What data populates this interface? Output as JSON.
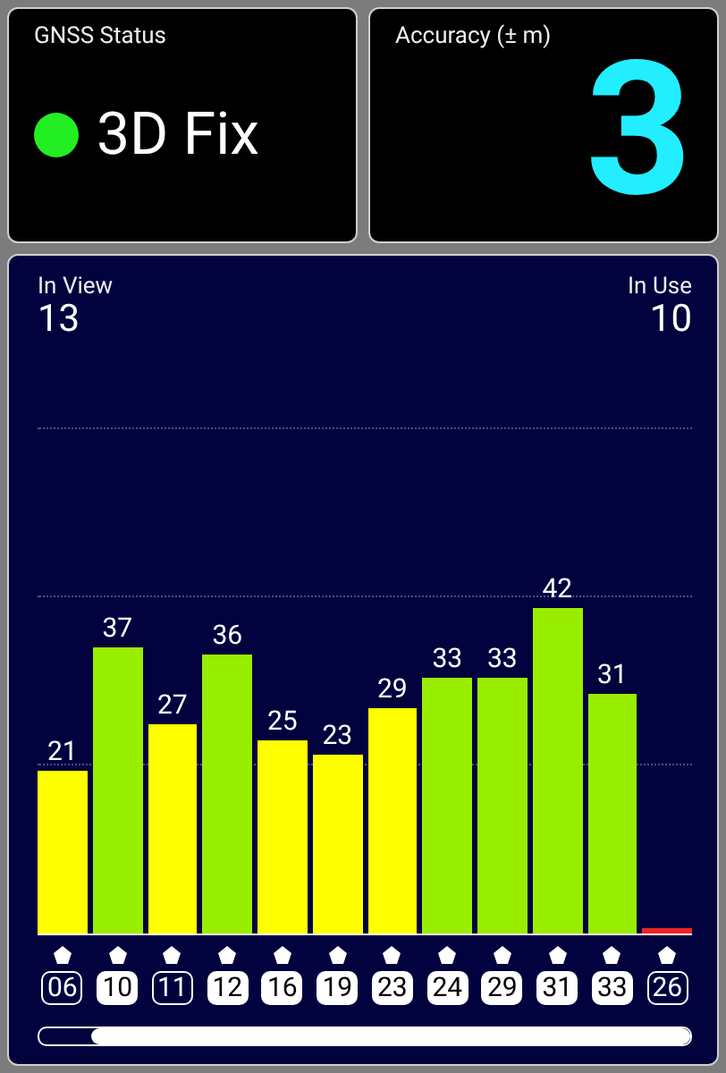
{
  "status_card": {
    "title": "GNSS Status",
    "fix": "3D Fix"
  },
  "accuracy_card": {
    "title": "Accuracy (± m)",
    "value": "3"
  },
  "satellites_panel": {
    "in_view_label": "In View",
    "in_view": "13",
    "in_use_label": "In Use",
    "in_use": "10",
    "satellites": [
      {
        "prn": "06",
        "snr": "21",
        "color": "#ffff00",
        "used": false
      },
      {
        "prn": "10",
        "snr": "37",
        "color": "#99ee00",
        "used": true
      },
      {
        "prn": "11",
        "snr": "27",
        "color": "#ffff00",
        "used": false
      },
      {
        "prn": "12",
        "snr": "36",
        "color": "#99ee00",
        "used": true
      },
      {
        "prn": "16",
        "snr": "25",
        "color": "#ffff00",
        "used": true
      },
      {
        "prn": "19",
        "snr": "23",
        "color": "#ffff00",
        "used": true
      },
      {
        "prn": "23",
        "snr": "29",
        "color": "#ffff00",
        "used": true
      },
      {
        "prn": "24",
        "snr": "33",
        "color": "#99ee00",
        "used": true
      },
      {
        "prn": "29",
        "snr": "33",
        "color": "#99ee00",
        "used": true
      },
      {
        "prn": "31",
        "snr": "42",
        "color": "#99ee00",
        "used": true
      },
      {
        "prn": "33",
        "snr": "31",
        "color": "#99ee00",
        "used": true
      },
      {
        "prn": "26",
        "color": "#ee2222",
        "used": false
      }
    ]
  }
}
